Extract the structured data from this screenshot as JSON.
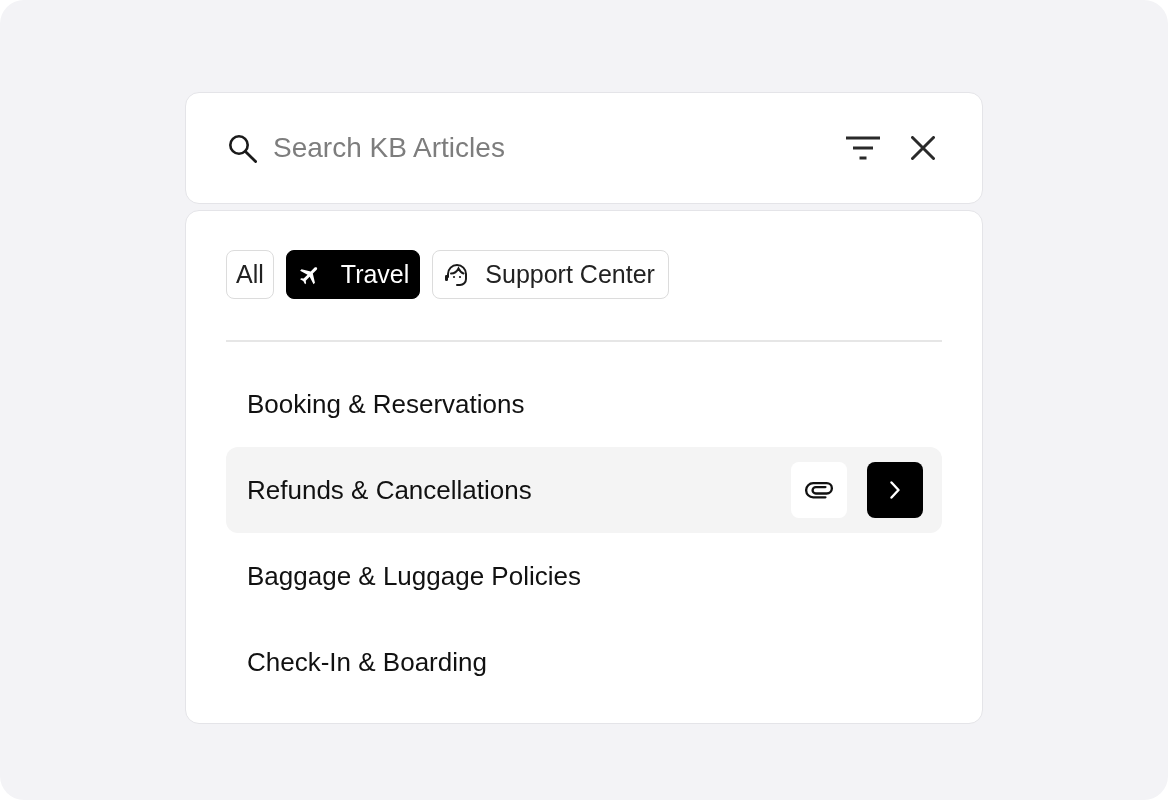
{
  "search": {
    "placeholder": "Search KB Articles"
  },
  "filters": [
    {
      "label": "All",
      "kind": "plain",
      "selected": false
    },
    {
      "label": "Travel",
      "kind": "plane",
      "selected": true
    },
    {
      "label": "Support Center",
      "kind": "agent",
      "selected": false
    }
  ],
  "articles": [
    {
      "title": "Booking & Reservations",
      "selected": false
    },
    {
      "title": "Refunds & Cancellations",
      "selected": true
    },
    {
      "title": "Baggage & Luggage Policies",
      "selected": false
    },
    {
      "title": "Check-In & Boarding",
      "selected": false
    }
  ]
}
